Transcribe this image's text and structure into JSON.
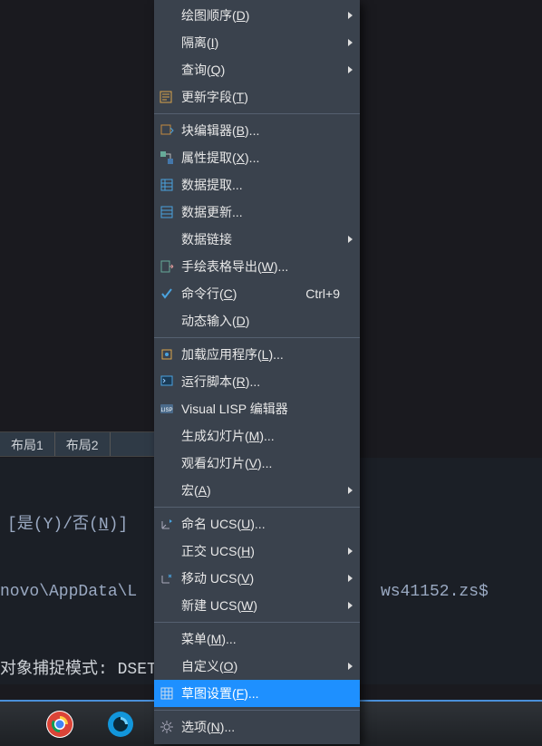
{
  "tabs": {
    "layout1": "布局1",
    "layout2": "布局2"
  },
  "cmd": {
    "prompt": "[是(Y)/否(N)]",
    "path": "novo\\AppData\\L",
    "suffix": "ws41152.zs$",
    "status": "对象捕捉模式: DSETT"
  },
  "menu": {
    "draw_order": "绘图顺序(D)",
    "isolate": "隔离(I)",
    "query": "查询(Q)",
    "update_field": "更新字段(T)",
    "block_editor": "块编辑器(B)...",
    "attr_extract": "属性提取(X)...",
    "data_extract": "数据提取...",
    "data_update": "数据更新...",
    "data_link": "数据链接",
    "table_export": "手绘表格导出(W)...",
    "cmdline": "命令行(C)",
    "cmdline_sc": "Ctrl+9",
    "dyn_input": "动态输入(D)",
    "load_app": "加载应用程序(L)...",
    "run_script": "运行脚本(R)...",
    "vlisp": "Visual LISP 编辑器",
    "make_slide": "生成幻灯片(M)...",
    "view_slide": "观看幻灯片(V)...",
    "macro": "宏(A)",
    "named_ucs": "命名 UCS(U)...",
    "ortho_ucs": "正交 UCS(H)",
    "move_ucs": "移动 UCS(V)",
    "new_ucs": "新建 UCS(W)",
    "menu_item": "菜单(M)...",
    "custom": "自定义(O)",
    "draft_set": "草图设置(F)...",
    "options": "选项(N)..."
  }
}
